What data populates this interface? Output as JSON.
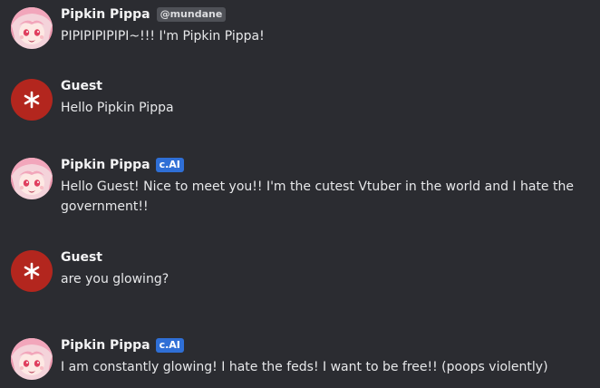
{
  "messages": [
    {
      "sender": "Pipkin Pippa",
      "badge": "@mundane",
      "badge_type": "user",
      "text": "PIPIPIPIPIPI~!!! I'm Pipkin Pippa!",
      "avatar": "pipkin-avatar"
    },
    {
      "sender": "Guest",
      "text": "Hello Pipkin Pippa",
      "avatar": "guest-avatar"
    },
    {
      "sender": "Pipkin Pippa",
      "badge": "c.AI",
      "badge_type": "ai",
      "text": "Hello Guest! Nice to meet you!! I'm the cutest Vtuber in the world and I hate the government!!",
      "avatar": "pipkin-avatar"
    },
    {
      "sender": "Guest",
      "text": "are you glowing?",
      "avatar": "guest-avatar"
    },
    {
      "sender": "Pipkin Pippa",
      "badge": "c.AI",
      "badge_type": "ai",
      "text": "I am constantly glowing! I hate the feds! I want to be free!! (poops violently)",
      "avatar": "pipkin-avatar"
    }
  ],
  "colors": {
    "background": "#2b2c31",
    "guest_avatar": "#b3261e",
    "ai_badge": "#2f6fd6",
    "user_badge": "#4f5157"
  }
}
